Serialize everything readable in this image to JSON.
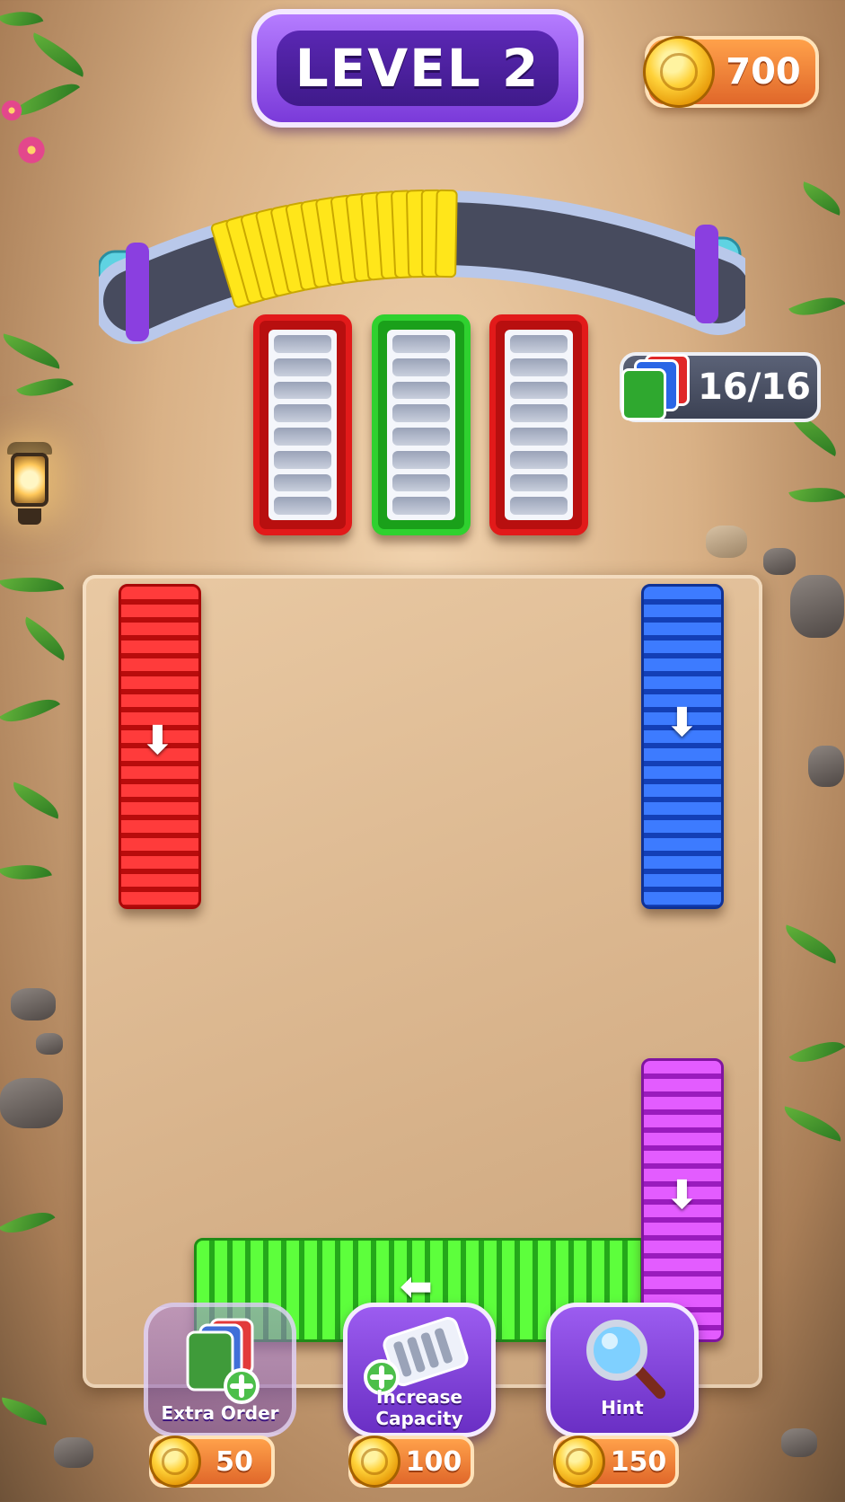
{
  "header": {
    "level_label": "LEVEL 2",
    "coins": "700"
  },
  "orders": {
    "progress": "16/16",
    "slots": [
      {
        "color": "#e21a1a",
        "name": "red"
      },
      {
        "color": "#2fd12f",
        "name": "green"
      },
      {
        "color": "#e21a1a",
        "name": "red"
      }
    ]
  },
  "conveyor": {
    "item_color": "#ffe61a",
    "item_count": 16
  },
  "board": {
    "stacks": [
      {
        "color": "red",
        "hex": "#e8181c",
        "direction": "down"
      },
      {
        "color": "blue",
        "hex": "#1f55e6",
        "direction": "down"
      },
      {
        "color": "purple",
        "hex": "#c433e6",
        "direction": "down"
      },
      {
        "color": "green",
        "hex": "#3ee02a",
        "direction": "left"
      }
    ]
  },
  "powerups": [
    {
      "label": "Extra Order",
      "price": "50",
      "icon": "cards-plus-icon"
    },
    {
      "label": "Increase Capacity",
      "price": "100",
      "icon": "tray-plus-icon"
    },
    {
      "label": "Hint",
      "price": "150",
      "icon": "magnifier-icon"
    }
  ]
}
